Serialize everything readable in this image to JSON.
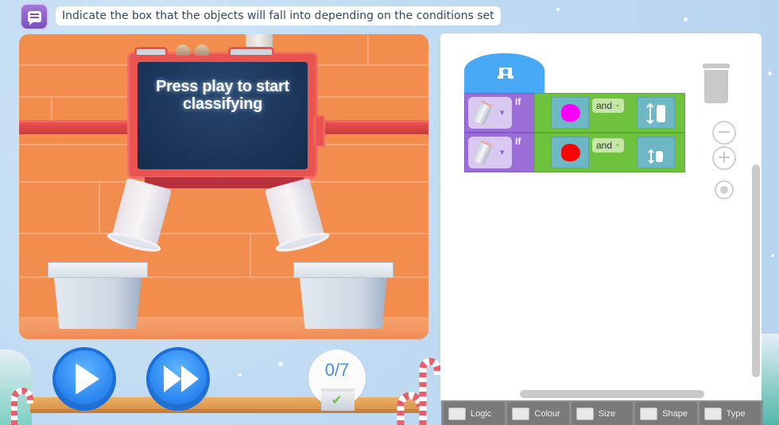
{
  "header": {
    "icon": "instructions-list-icon",
    "instruction": "Indicate the box that the objects will fall into depending on the conditions set"
  },
  "scene": {
    "screen_message": "Press play to start classifying",
    "bins": [
      "left-bin",
      "right-bin"
    ]
  },
  "controls": {
    "play_icon": "play-icon",
    "fast_forward_icon": "fast-forward-icon",
    "progress": {
      "done": 0,
      "total": 7,
      "label": "0/7"
    }
  },
  "workspace": {
    "start_block_icon": "robot-icon",
    "rules": [
      {
        "object": "can",
        "if_label": "If",
        "colour": "magenta",
        "colour_hex": "#ff00ff",
        "operator": "and",
        "size": "tall"
      },
      {
        "object": "can",
        "if_label": "If",
        "colour": "red",
        "colour_hex": "#ff0000",
        "operator": "and",
        "size": "small"
      }
    ],
    "tools": [
      "trash-icon",
      "zoom-out-icon",
      "zoom-in-icon",
      "recenter-icon"
    ]
  },
  "toolbox": {
    "categories": [
      {
        "label": "Logic",
        "icon": "logic-icon"
      },
      {
        "label": "Colour",
        "icon": "colour-icon"
      },
      {
        "label": "Size",
        "icon": "size-icon"
      },
      {
        "label": "Shape",
        "icon": "shape-icon"
      },
      {
        "label": "Type",
        "icon": "type-icon"
      }
    ]
  },
  "colors": {
    "start_block": "#48aaf7",
    "if_block": "#9a6ed6",
    "condition_block": "#6ec23e",
    "play_button": "#2a86f0"
  }
}
